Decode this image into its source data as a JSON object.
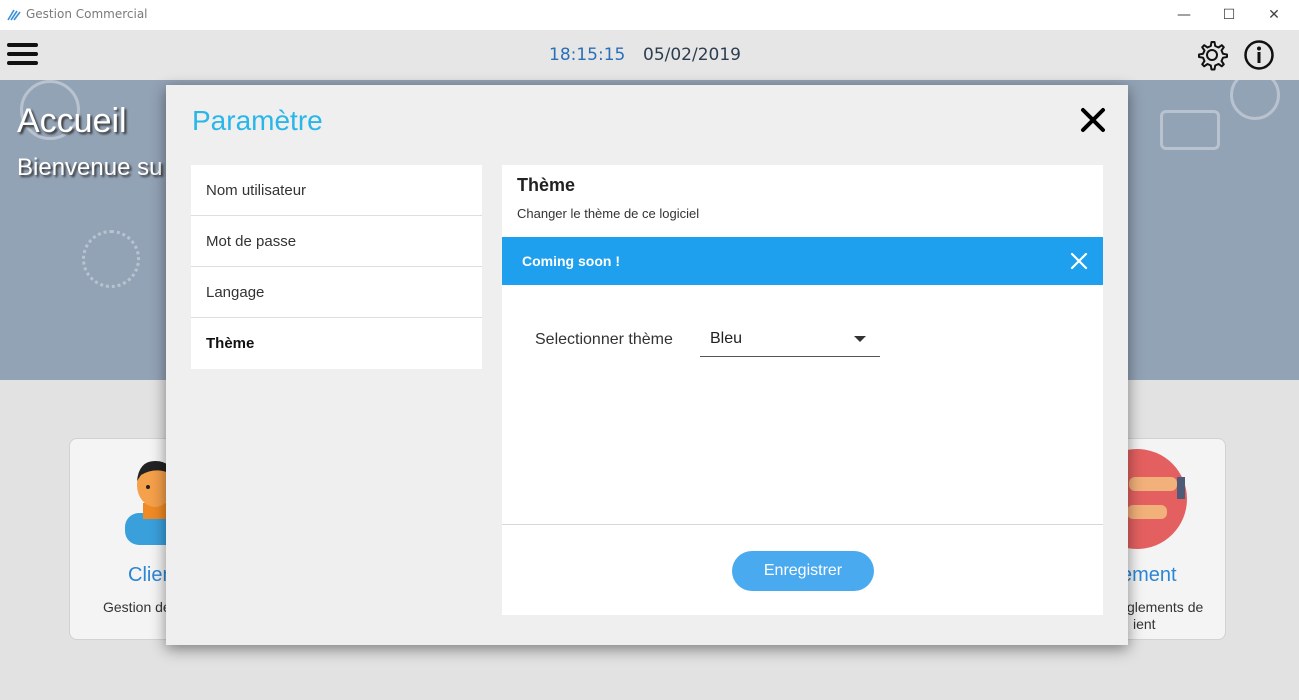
{
  "window": {
    "title": "Gestion Commercial",
    "minimize_glyph": "—",
    "maximize_glyph": "☐",
    "close_glyph": "✕"
  },
  "header": {
    "time": "18:15:15",
    "date": "05/02/2019",
    "icons": [
      "hamburger-menu-icon",
      "gear-icon",
      "info-icon"
    ]
  },
  "banner": {
    "title": "Accueil",
    "subtitle": "Bienvenue su"
  },
  "cards": {
    "left": {
      "title": "Clien",
      "desc": "Gestion de"
    },
    "right": {
      "title": "ement",
      "desc_line1": "glements de",
      "desc_line2": "ient"
    }
  },
  "modal": {
    "title": "Paramètre",
    "menu": [
      {
        "label": "Nom utilisateur",
        "active": false
      },
      {
        "label": "Mot de passe",
        "active": false
      },
      {
        "label": "Langage",
        "active": false
      },
      {
        "label": "Thème",
        "active": true
      }
    ],
    "panel": {
      "title": "Thème",
      "subtitle": "Changer le thème de ce logiciel",
      "alert": "Coming soon !",
      "select_label": "Selectionner thème",
      "select_value": "Bleu",
      "save_label": "Enregistrer"
    }
  },
  "colors": {
    "accent": "#29b6e8",
    "alert_bg": "#1fa0ee",
    "button_bg": "#4aaaf0",
    "clock": "#2a70b8"
  }
}
